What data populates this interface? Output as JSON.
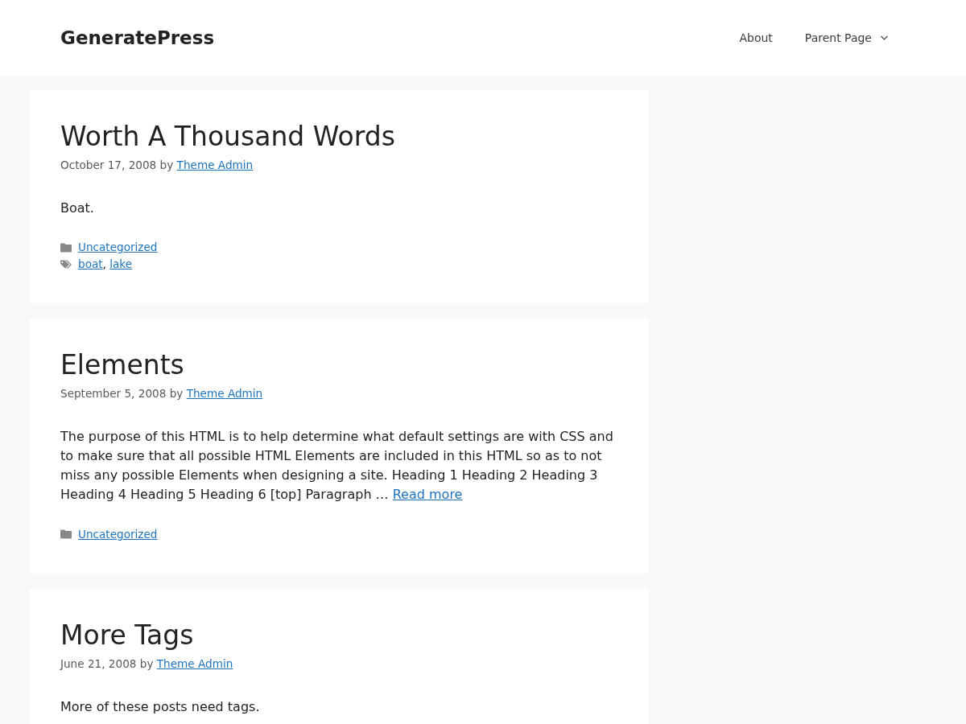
{
  "site": {
    "title": "GeneratePress"
  },
  "nav": [
    {
      "label": "About",
      "has_submenu": false
    },
    {
      "label": "Parent Page",
      "has_submenu": true
    }
  ],
  "posts": [
    {
      "title": "Worth A Thousand Words",
      "date": "October 17, 2008",
      "by": "by",
      "author": "Theme Admin",
      "excerpt": "Boat.",
      "categories": [
        "Uncategorized"
      ],
      "tags": {
        "items": [
          "boat",
          "lake"
        ],
        "separator": ","
      }
    },
    {
      "title": "Elements",
      "date": "September 5, 2008",
      "by": "by",
      "author": "Theme Admin",
      "excerpt": "The purpose of this HTML is to help determine what default settings are with CSS and to make sure that all possible HTML Elements are included in this HTML so as to not miss any possible Elements when designing a site. Heading 1 Heading 2 Heading 3 Heading 4 Heading 5 Heading 6 [top] Paragraph …",
      "read_more": "Read more",
      "categories": [
        "Uncategorized"
      ]
    },
    {
      "title": "More Tags",
      "date": "June 21, 2008",
      "by": "by",
      "author": "Theme Admin",
      "excerpt": "More of these posts need tags."
    }
  ]
}
